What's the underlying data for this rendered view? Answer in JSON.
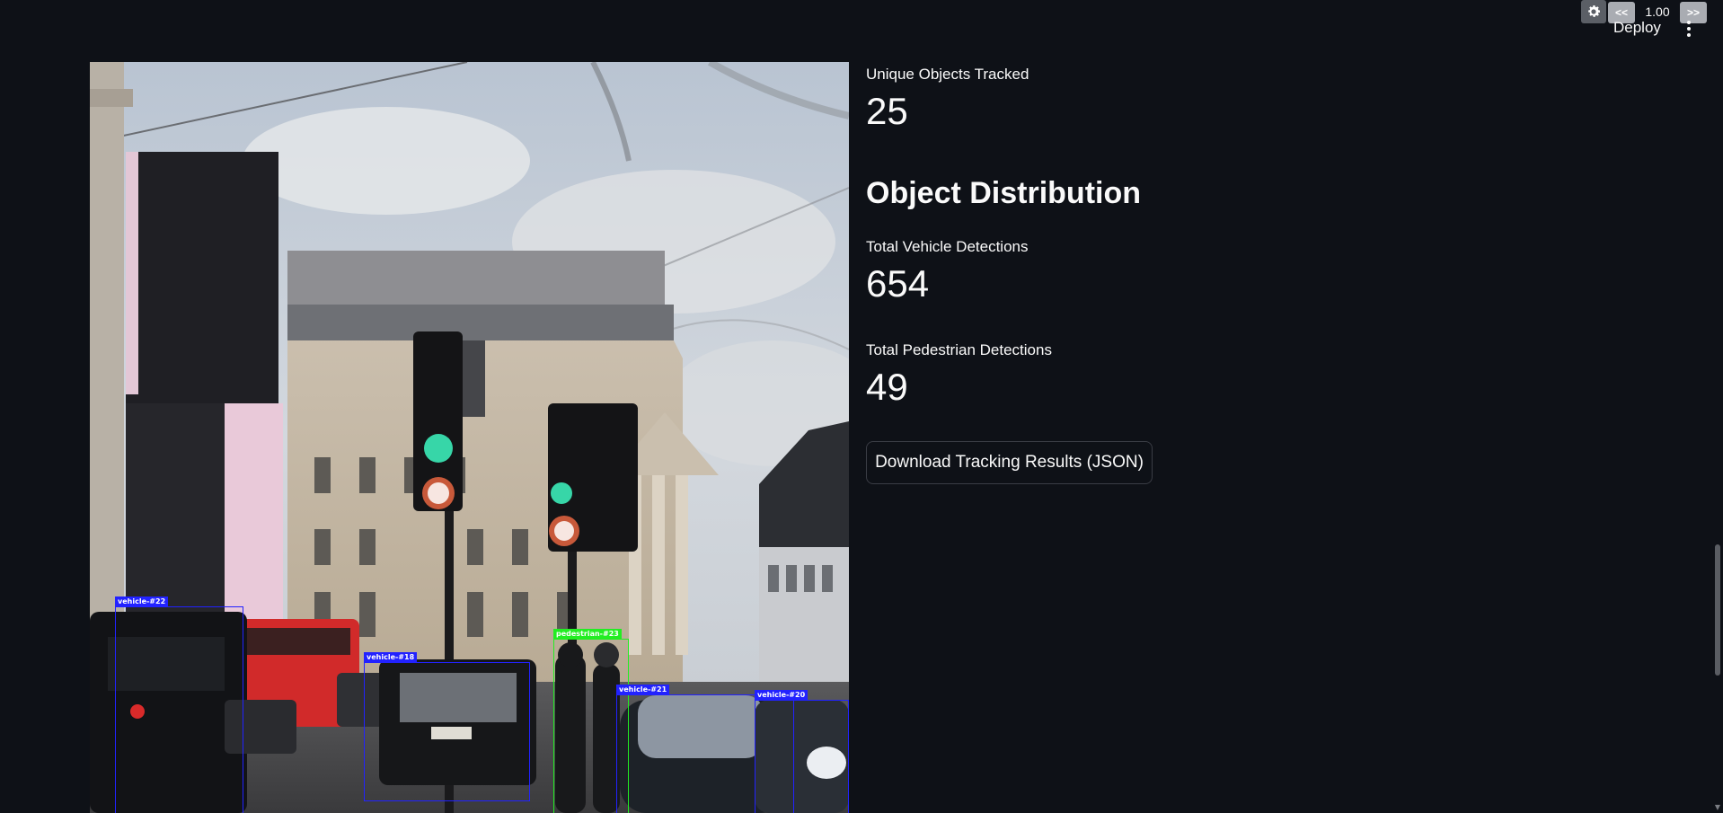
{
  "toolbar": {
    "deploy_label": "Deploy",
    "speed_prev_label": "<<",
    "speed_value": "1.00",
    "speed_next_label": ">>",
    "settings_icon": "gear-icon",
    "menu_icon": "kebab-menu-icon"
  },
  "video_frame": {
    "detections": [
      {
        "label": "vehicle-#22",
        "class": "vehicle"
      },
      {
        "label": "vehicle-#18",
        "class": "vehicle"
      },
      {
        "label": "pedestrian-#23",
        "class": "pedestrian"
      },
      {
        "label": "vehicle-#21",
        "class": "vehicle"
      },
      {
        "label": "vehicle-#20",
        "class": "vehicle"
      }
    ],
    "colors": {
      "vehicle": "#2222ff",
      "pedestrian": "#22ee22"
    }
  },
  "metrics": {
    "unique_objects_label": "Unique Objects Tracked",
    "unique_objects_value": "25",
    "distribution_heading": "Object Distribution",
    "vehicle_label": "Total Vehicle Detections",
    "vehicle_value": "654",
    "pedestrian_label": "Total Pedestrian Detections",
    "pedestrian_value": "49"
  },
  "actions": {
    "download_label": "Download Tracking Results (JSON)"
  },
  "theme": {
    "background": "#0e1117",
    "text": "#fafafa"
  }
}
